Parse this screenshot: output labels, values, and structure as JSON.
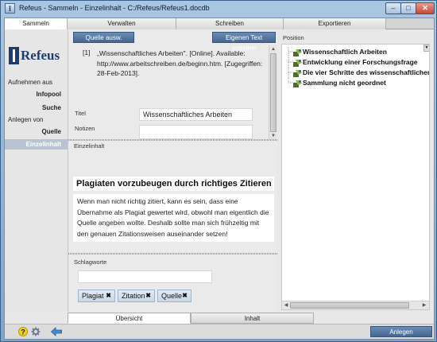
{
  "window": {
    "title": "Refeus - Sammeln - Einzelinhalt - C:/Refeus/Refeus1.docdb",
    "icon_letter": "I",
    "min_glyph": "–",
    "max_glyph": "□",
    "close_glyph": "✕"
  },
  "tabs": [
    "Sammeln",
    "Verwalten",
    "Schreiben",
    "Exportieren"
  ],
  "logo": {
    "text": "Refeus"
  },
  "leftnav": {
    "aufnehmen_aus": "Aufnehmen aus",
    "infopool": "Infopool",
    "suche": "Suche",
    "anlegen_von": "Anlegen von",
    "quelle": "Quelle",
    "einzelinhalt": "Einzelinhalt"
  },
  "source": {
    "select_button": "Quelle ausw.",
    "own_text_button": "Eigenen Text erstellen",
    "ref_number": "[1]",
    "ref_text": "„Wissenschaftliches Arbeiten\". [Online]. Available: http://www.arbeitschreiben.de/beginn.htm. [Zugegriffen: 28-Feb-2013].",
    "title_label": "Titel",
    "title_value": "Wissenschaftliches Arbeiten",
    "notes_label": "Notizen",
    "notes_value": ""
  },
  "content": {
    "section_label": "Einzelinhalt",
    "heading": "Plagiaten vorzubeugen durch richtiges Zitieren",
    "paragraph": "Wenn man nicht richtig zitiert, kann es sein, dass eine Übernahme als Plagiat gewertet wird, obwohl man eigentlich die Quelle angeben wollte. Deshalb sollte man sich frühzeitig mit den genauen Zitationsweisen auseinander setzen!"
  },
  "keywords": {
    "label": "Schlagworte",
    "input_value": "",
    "tags": [
      "Plagiat",
      "Zitation",
      "Quelle"
    ],
    "remove_glyph": "✖"
  },
  "position": {
    "label": "Position",
    "items": [
      "Wissenschaftlich Arbeiten",
      "Entwicklung einer Forschungsfrage",
      "Die vier Schritte des wissenschaftlichen",
      "Sammlung nicht geordnet"
    ]
  },
  "bottom_tabs": [
    "Übersicht",
    "Inhalt"
  ],
  "footer": {
    "help_icon": "help-icon",
    "settings_icon": "gear-icon",
    "back_icon": "back-arrow-icon",
    "submit_button": "Anlegen"
  },
  "colors": {
    "accent": "#45678f",
    "brand": "#1e3c6e",
    "tree_icon": "#6b8e23"
  }
}
